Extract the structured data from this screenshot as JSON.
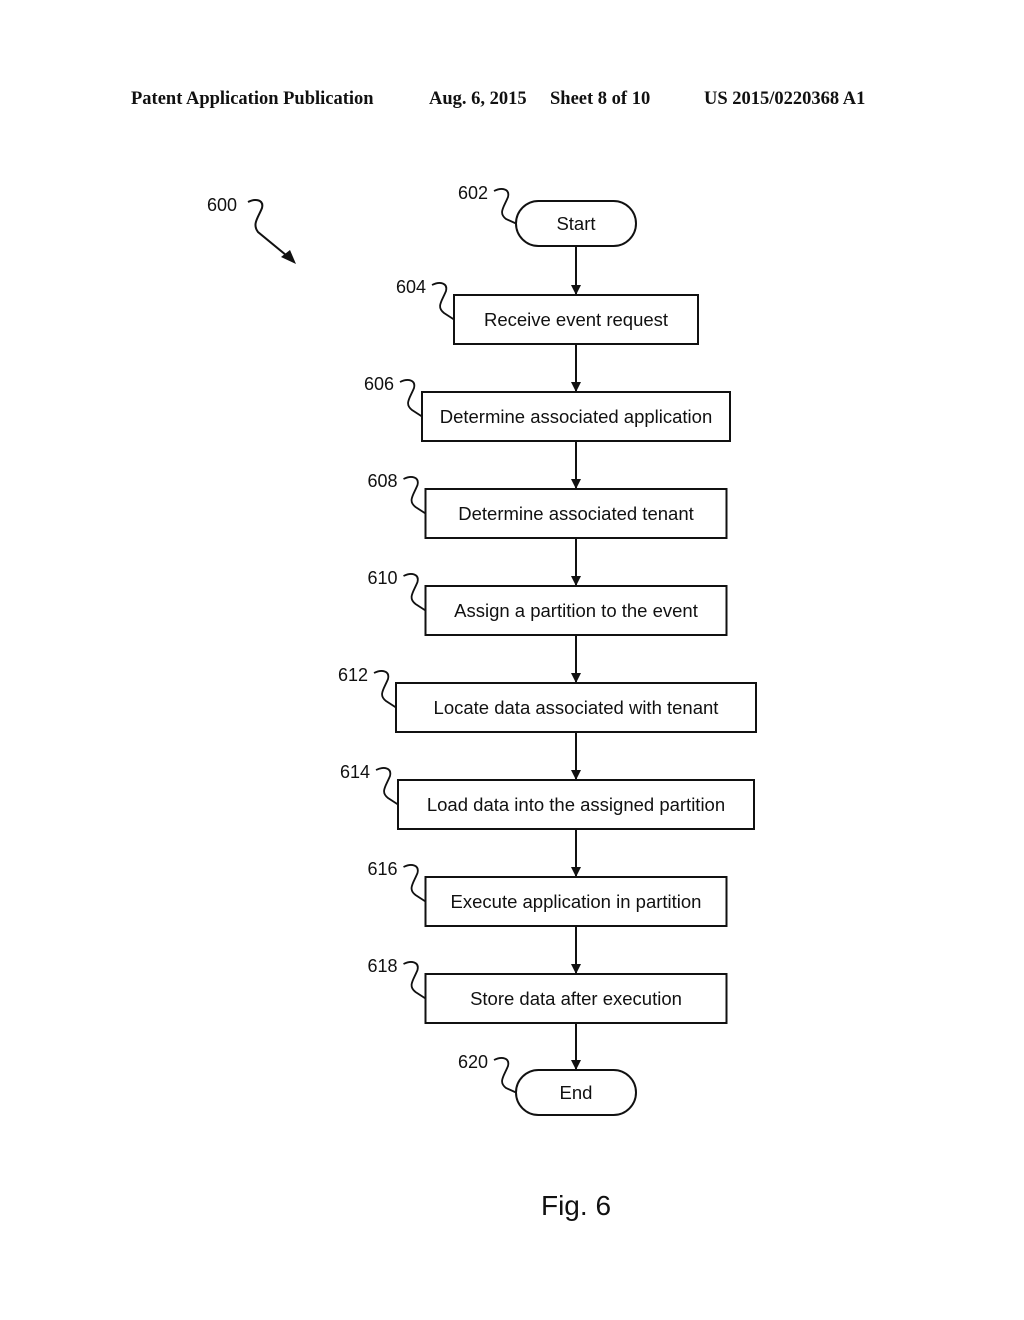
{
  "header": {
    "publication": "Patent Application Publication",
    "date": "Aug. 6, 2015",
    "sheet": "Sheet 8 of 10",
    "number": "US 2015/0220368 A1"
  },
  "figure": {
    "ref": "600",
    "caption": "Fig. 6"
  },
  "flowchart": {
    "nodes": [
      {
        "id": "602",
        "ref": "602",
        "shape": "terminal",
        "label": "Start"
      },
      {
        "id": "604",
        "ref": "604",
        "shape": "process",
        "label": "Receive event request"
      },
      {
        "id": "606",
        "ref": "606",
        "shape": "process",
        "label": "Determine associated application"
      },
      {
        "id": "608",
        "ref": "608",
        "shape": "process",
        "label": "Determine associated tenant"
      },
      {
        "id": "610",
        "ref": "610",
        "shape": "process",
        "label": "Assign a partition to the event"
      },
      {
        "id": "612",
        "ref": "612",
        "shape": "process",
        "label": "Locate data associated with tenant"
      },
      {
        "id": "614",
        "ref": "614",
        "shape": "process",
        "label": "Load data into the assigned partition"
      },
      {
        "id": "616",
        "ref": "616",
        "shape": "process",
        "label": "Execute application in partition"
      },
      {
        "id": "618",
        "ref": "618",
        "shape": "process",
        "label": "Store data after execution"
      },
      {
        "id": "620",
        "ref": "620",
        "shape": "terminal",
        "label": "End"
      }
    ],
    "edges": [
      {
        "from": "602",
        "to": "604"
      },
      {
        "from": "604",
        "to": "606"
      },
      {
        "from": "606",
        "to": "608"
      },
      {
        "from": "608",
        "to": "610"
      },
      {
        "from": "610",
        "to": "612"
      },
      {
        "from": "612",
        "to": "614"
      },
      {
        "from": "614",
        "to": "616"
      },
      {
        "from": "616",
        "to": "618"
      },
      {
        "from": "618",
        "to": "620"
      }
    ]
  }
}
